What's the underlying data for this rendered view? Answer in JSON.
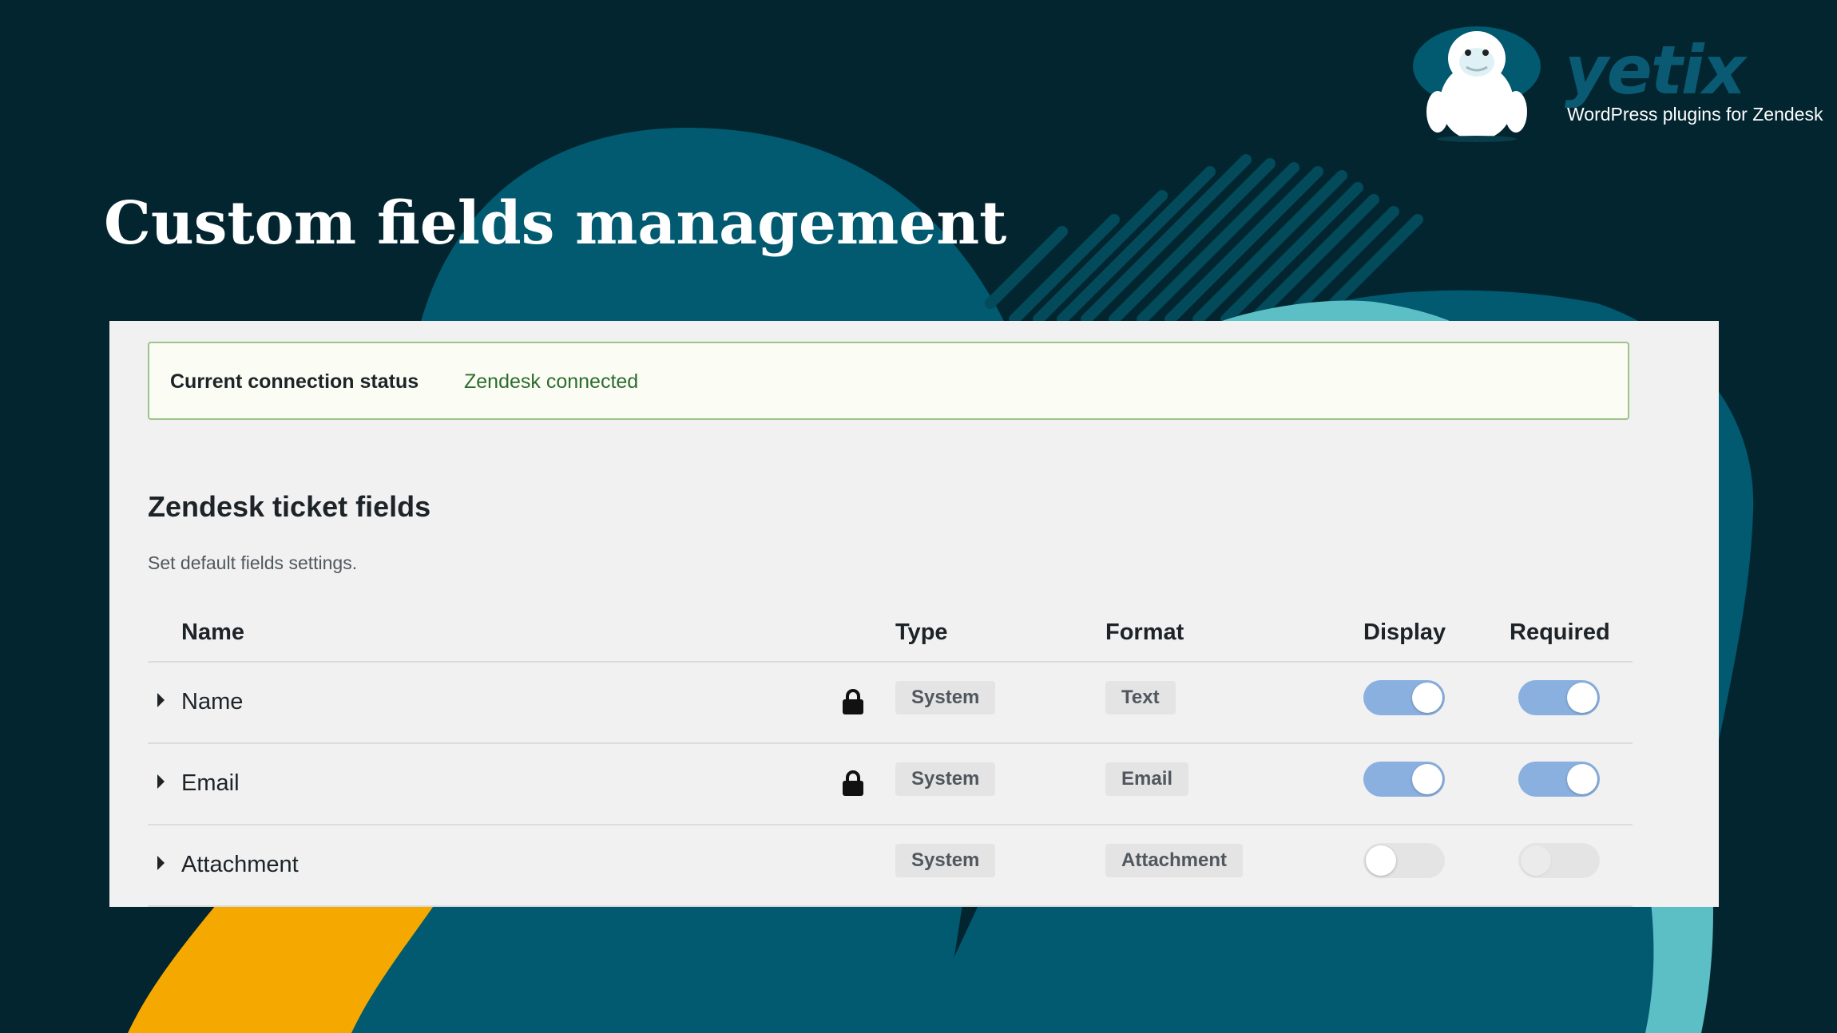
{
  "brand": {
    "name": "yetix",
    "tagline": "WordPress plugins for Zendesk",
    "colors": {
      "background": "#022530",
      "blob": "#015a6f",
      "teal": "#5cbfc6",
      "orange": "#f5a800"
    }
  },
  "page": {
    "title": "Custom fields management"
  },
  "status": {
    "label": "Current connection status",
    "value": "Zendesk connected"
  },
  "section": {
    "title": "Zendesk ticket fields",
    "description": "Set default fields settings."
  },
  "table": {
    "headers": {
      "name": "Name",
      "type": "Type",
      "format": "Format",
      "display": "Display",
      "required": "Required"
    },
    "rows": [
      {
        "name": "Name",
        "locked": true,
        "lock_icon": "lock-icon",
        "type": "System",
        "format": "Text",
        "display": true,
        "required": true,
        "required_disabled": false
      },
      {
        "name": "Email",
        "locked": true,
        "lock_icon": "lock-icon",
        "type": "System",
        "format": "Email",
        "display": true,
        "required": true,
        "required_disabled": false
      },
      {
        "name": "Attachment",
        "locked": false,
        "type": "System",
        "format": "Attachment",
        "display": false,
        "required": false,
        "required_disabled": true
      }
    ]
  }
}
